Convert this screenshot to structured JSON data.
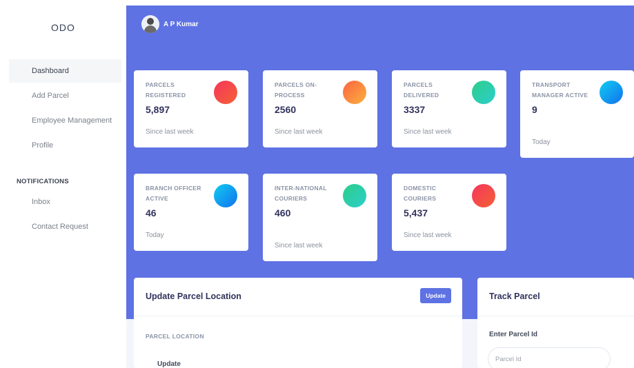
{
  "sidebar": {
    "brand": "ODO",
    "items": [
      {
        "label": "Dashboard"
      },
      {
        "label": "Add Parcel"
      },
      {
        "label": "Employee Management"
      },
      {
        "label": "Profile"
      }
    ],
    "notifications_heading": "NOTIFICATIONS",
    "notification_items": [
      {
        "label": "Inbox"
      },
      {
        "label": "Contact Request"
      }
    ]
  },
  "header": {
    "user_name": "A P Kumar",
    "avatar_icon": "user-avatar-icon"
  },
  "stats": [
    {
      "title": "PARCELS REGISTERED",
      "value": "5,897",
      "note": "Since last week",
      "color": "red"
    },
    {
      "title": "PARCELS ON-PROCESS",
      "value": "2560",
      "note": "Since last week",
      "color": "orange"
    },
    {
      "title": "PARCELS DELIVERED",
      "value": "3337",
      "note": "Since last week",
      "color": "green"
    },
    {
      "title": "TRANSPORT MANAGER ACTIVE",
      "value": "9",
      "note": "Today",
      "color": "blue"
    },
    {
      "title": "BRANCH OFFICER ACTIVE",
      "value": "46",
      "note": "Today",
      "color": "blue"
    },
    {
      "title": "INTER-NATIONAL COURIERS",
      "value": "460",
      "note": "Since last week",
      "color": "green"
    },
    {
      "title": "DOMESTIC COURIERS",
      "value": "5,437",
      "note": "Since last week",
      "color": "red"
    }
  ],
  "update_panel": {
    "title": "Update Parcel Location",
    "button_label": "Update",
    "section_label": "PARCEL LOCATION",
    "field_label": "Update"
  },
  "track_panel": {
    "title": "Track Parcel",
    "field_label": "Enter Parcel Id",
    "placeholder": "Parcel Id"
  },
  "colors": {
    "primary": "#5e72e4",
    "red": "#f5365c",
    "orange": "#fb6340",
    "green": "#2dce89",
    "blue": "#11cdef"
  }
}
